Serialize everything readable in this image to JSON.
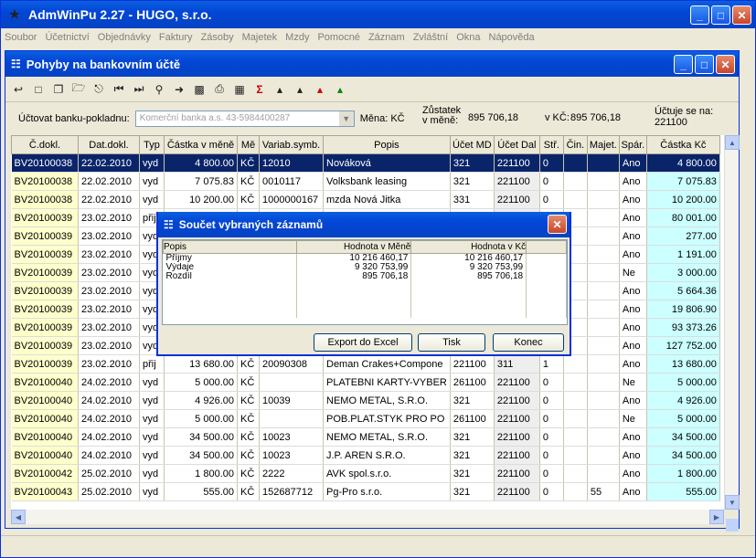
{
  "app": {
    "title": "AdmWinPu 2.27 - HUGO, s.r.o."
  },
  "menu": [
    "Soubor",
    "Účetnictví",
    "Objednávky",
    "Faktury",
    "Zásoby",
    "Majetek",
    "Mzdy",
    "Pomocné",
    "Záznam",
    "Zvláštní",
    "Okna",
    "Nápověda"
  ],
  "child": {
    "title": "Pohyby na bankovním účtě"
  },
  "filter": {
    "label": "Účtovat banku-pokladnu:",
    "bank": "Komerční banka a.s. 43-5984400287",
    "currency": "Měna: KČ",
    "balance_label": "Zůstatek v měně:",
    "balance": "895 706,18",
    "kc_label": "v KČ:",
    "kc": "895 706,18",
    "account_label": "Účtuje se na:",
    "account": "221100"
  },
  "table": {
    "headers": [
      "Č.dokl.",
      "Dat.dokl.",
      "Typ",
      "Částka v měně",
      "Mě",
      "Variab.symb.",
      "Popis",
      "Účet MD",
      "Účet Dal",
      "Stř.",
      "Čin.",
      "Majet.",
      "Spár.",
      "Částka Kč"
    ],
    "rows": [
      [
        "BV20100038",
        "22.02.2010",
        "vyd",
        "4 800.00",
        "KČ",
        "12010",
        "Nováková",
        "321",
        "221100",
        "0",
        "",
        "",
        "Ano",
        "4 800.00"
      ],
      [
        "BV20100038",
        "22.02.2010",
        "vyd",
        "7 075.83",
        "KČ",
        "0010117",
        "Volksbank leasing",
        "321",
        "221100",
        "0",
        "",
        "",
        "Ano",
        "7 075.83"
      ],
      [
        "BV20100038",
        "22.02.2010",
        "vyd",
        "10 200.00",
        "KČ",
        "1000000167",
        "mzda Nová Jitka",
        "331",
        "221100",
        "0",
        "",
        "",
        "Ano",
        "10 200.00"
      ],
      [
        "BV20100039",
        "23.02.2010",
        "přij",
        "",
        "",
        "",
        "",
        "",
        "",
        "",
        "",
        "",
        "Ano",
        "80 001.00"
      ],
      [
        "BV20100039",
        "23.02.2010",
        "vyd",
        "",
        "",
        "",
        "",
        "",
        "",
        "",
        "",
        "",
        "Ano",
        "277.00"
      ],
      [
        "BV20100039",
        "23.02.2010",
        "vyd",
        "",
        "",
        "",
        "",
        "",
        "",
        "",
        "",
        "",
        "Ano",
        "1 191.00"
      ],
      [
        "BV20100039",
        "23.02.2010",
        "vyd",
        "",
        "",
        "",
        "",
        "",
        "",
        "",
        "",
        "",
        "Ne",
        "3 000.00"
      ],
      [
        "BV20100039",
        "23.02.2010",
        "vyd",
        "",
        "",
        "",
        "",
        "",
        "",
        "",
        "",
        "",
        "Ano",
        "5 664.36"
      ],
      [
        "BV20100039",
        "23.02.2010",
        "vyd",
        "",
        "",
        "",
        "",
        "",
        "",
        "",
        "",
        "",
        "Ano",
        "19 806.90"
      ],
      [
        "BV20100039",
        "23.02.2010",
        "vyd",
        "",
        "",
        "",
        "",
        "",
        "",
        "",
        "",
        "",
        "Ano",
        "93 373.26"
      ],
      [
        "BV20100039",
        "23.02.2010",
        "vyd",
        "",
        "",
        "",
        "",
        "",
        "",
        "",
        "",
        "",
        "Ano",
        "127 752.00"
      ],
      [
        "BV20100039",
        "23.02.2010",
        "přij",
        "13 680.00",
        "KČ",
        "20090308",
        "Deman Crakes+Compone",
        "221100",
        "311",
        "1",
        "",
        "",
        "Ano",
        "13 680.00"
      ],
      [
        "BV20100040",
        "24.02.2010",
        "vyd",
        "5 000.00",
        "KČ",
        "",
        "PLATEBNI KARTY-VYBER",
        "261100",
        "221100",
        "0",
        "",
        "",
        "Ne",
        "5 000.00"
      ],
      [
        "BV20100040",
        "24.02.2010",
        "vyd",
        "4 926.00",
        "KČ",
        "10039",
        "NEMO METAL, S.R.O.",
        "321",
        "221100",
        "0",
        "",
        "",
        "Ano",
        "4 926.00"
      ],
      [
        "BV20100040",
        "24.02.2010",
        "vyd",
        "5 000.00",
        "KČ",
        "",
        "POB.PLAT.STYK PRO PO",
        "261100",
        "221100",
        "0",
        "",
        "",
        "Ne",
        "5 000.00"
      ],
      [
        "BV20100040",
        "24.02.2010",
        "vyd",
        "34 500.00",
        "KČ",
        "10023",
        "NEMO METAL, S.R.O.",
        "321",
        "221100",
        "0",
        "",
        "",
        "Ano",
        "34 500.00"
      ],
      [
        "BV20100040",
        "24.02.2010",
        "vyd",
        "34 500.00",
        "KČ",
        "10023",
        "J.P. AREN S.R.O.",
        "321",
        "221100",
        "0",
        "",
        "",
        "Ano",
        "34 500.00"
      ],
      [
        "BV20100042",
        "25.02.2010",
        "vyd",
        "1 800.00",
        "KČ",
        "2222",
        "AVK spol.s.r.o.",
        "321",
        "221100",
        "0",
        "",
        "",
        "Ano",
        "1 800.00"
      ],
      [
        "BV20100043",
        "25.02.2010",
        "vyd",
        "555.00",
        "KČ",
        "152687712",
        "Pg-Pro s.r.o.",
        "321",
        "221100",
        "0",
        "",
        "55",
        "Ano",
        "555.00"
      ]
    ]
  },
  "dialog": {
    "title": "Součet vybraných záznamů",
    "headers": [
      "Popis",
      "Hodnota v Měně",
      "Hodnota v Kč"
    ],
    "rows": [
      [
        "Příjmy",
        "10 216 460,17",
        "10 216 460,17"
      ],
      [
        "Výdaje",
        "9 320 753,99",
        "9 320 753,99"
      ],
      [
        "Rozdíl",
        "895 706,18",
        "895 706,18"
      ]
    ],
    "export_label": "Export do Excel",
    "print_label": "Tisk",
    "close_label": "Konec"
  }
}
